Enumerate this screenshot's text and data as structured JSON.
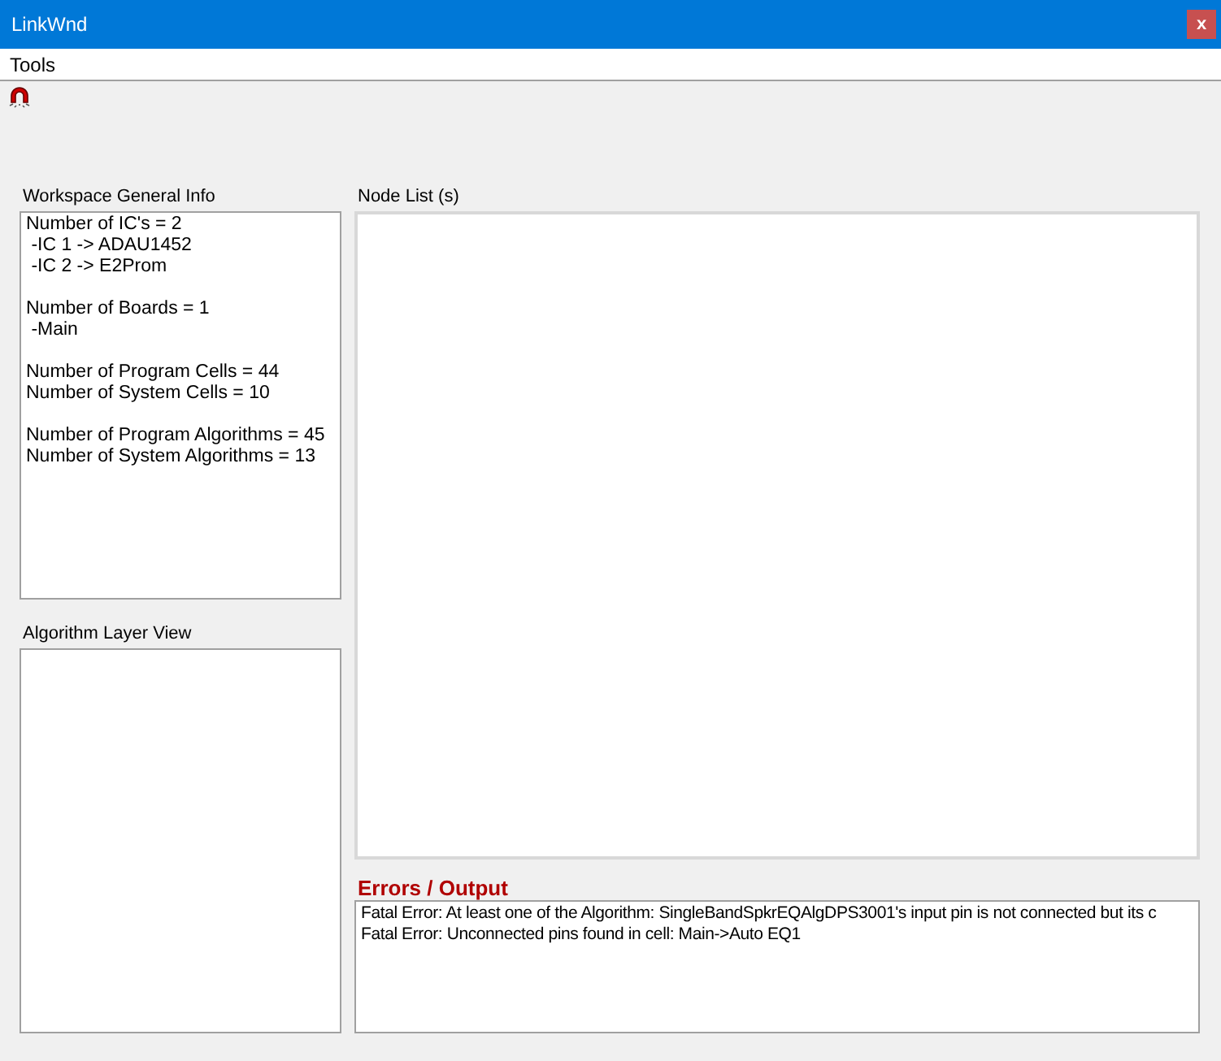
{
  "window": {
    "title": "LinkWnd",
    "close": "x"
  },
  "menu": [
    "Tools"
  ],
  "workspace_info": {
    "title": "Workspace General Info",
    "groups": [
      [
        "Number of IC's = 2",
        " -IC 1 -> ADAU1452",
        " -IC 2 -> E2Prom"
      ],
      [
        "Number of Boards = 1",
        " -Main"
      ],
      [
        "Number of Program Cells = 44",
        "Number of System Cells = 10"
      ],
      [
        "Number of Program Algorithms = 45",
        "Number of System Algorithms = 13"
      ]
    ]
  },
  "algorithm_layer_view": {
    "title": "Algorithm Layer View"
  },
  "node_list": {
    "title": "Node List (s)"
  },
  "errors_output": {
    "title": "Errors / Output",
    "lines": [
      "Fatal Error: At least one of the Algorithm: SingleBandSpkrEQAlgDPS3001's input pin is not connected but its c",
      "Fatal Error: Unconnected pins found in cell: Main->Auto EQ1"
    ]
  }
}
